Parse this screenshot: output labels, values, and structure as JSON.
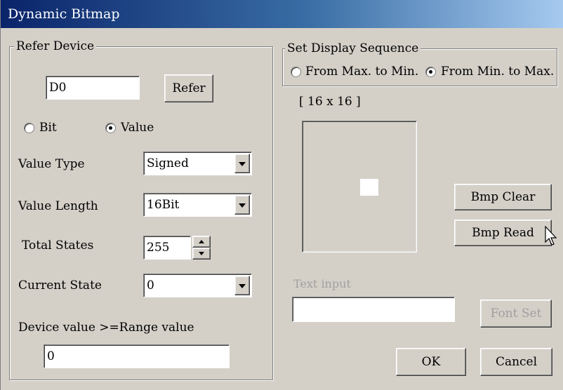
{
  "window": {
    "title": "Dynamic Bitmap"
  },
  "refer_device": {
    "group_label": "Refer Device",
    "device_value": "D0",
    "refer_button": "Refer",
    "radio_bit": "Bit",
    "radio_value": "Value",
    "selected": "Value",
    "value_type_label": "Value Type",
    "value_type": "Signed",
    "value_length_label": "Value Length",
    "value_length": "16Bit",
    "total_states_label": "Total States",
    "total_states": "255",
    "current_state_label": "Current State",
    "current_state": "0",
    "range_label": "Device value >=Range value",
    "range_value": "0"
  },
  "display_sequence": {
    "group_label": "Set Display Sequence",
    "option_max_to_min": "From Max. to Min.",
    "option_min_to_max": "From Min. to Max.",
    "selected": "From Min. to Max."
  },
  "bitmap": {
    "size_label": "[ 16 x 16 ]",
    "bmp_clear": "Bmp Clear",
    "bmp_read": "Bmp Read"
  },
  "text_input": {
    "label": "Text input",
    "value": "",
    "font_set": "Font Set"
  },
  "footer": {
    "ok": "OK",
    "cancel": "Cancel"
  }
}
